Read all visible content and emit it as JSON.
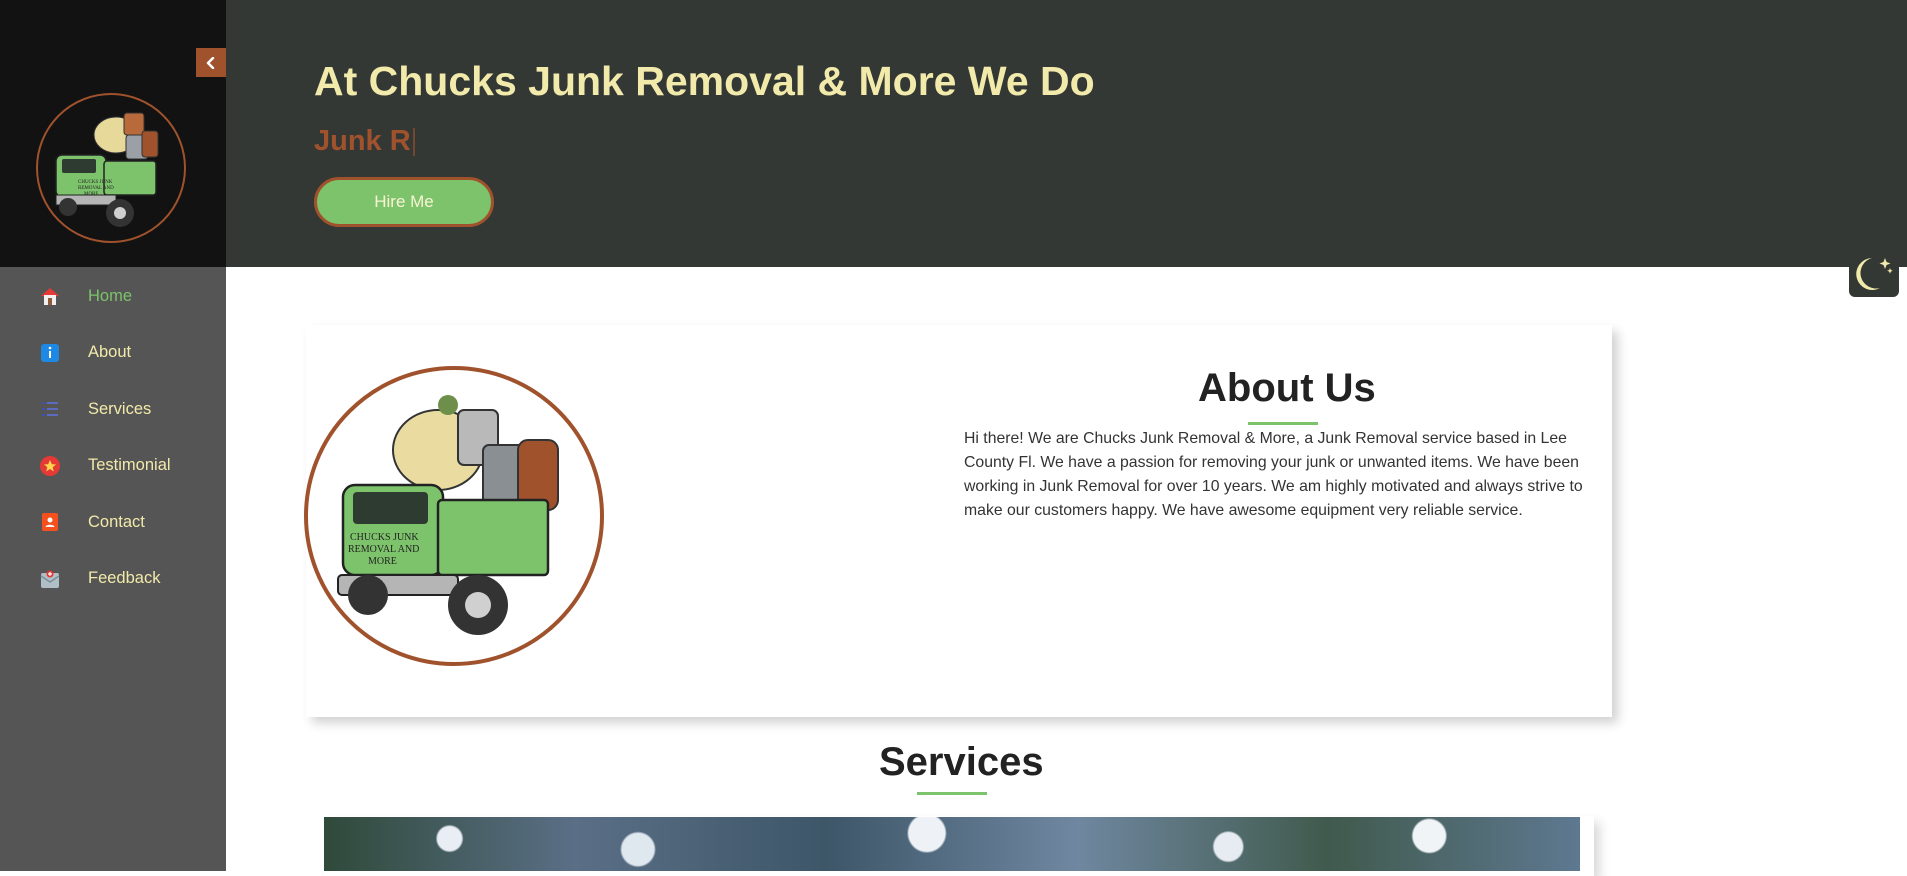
{
  "sidebar": {
    "toggle_icon": "chevron-left-icon",
    "logo_alt": "Chucks Junk Removal and More logo",
    "logo_truck_text": "CHUCKS JUNK REMOVAL AND MORE",
    "items": [
      {
        "label": "Home",
        "icon": "home-icon",
        "active": true
      },
      {
        "label": "About",
        "icon": "info-icon",
        "active": false
      },
      {
        "label": "Services",
        "icon": "list-icon",
        "active": false
      },
      {
        "label": "Testimonial",
        "icon": "star-icon",
        "active": false
      },
      {
        "label": "Contact",
        "icon": "contact-icon",
        "active": false
      },
      {
        "label": "Feedback",
        "icon": "feedback-icon",
        "active": false
      }
    ]
  },
  "hero": {
    "title": "At Chucks Junk Removal & More We Do",
    "typed_text": "Junk R",
    "hire_button": "Hire Me"
  },
  "mode_toggle": {
    "icon": "moon-icon"
  },
  "about": {
    "heading": "About Us",
    "text": "Hi there! We are Chucks Junk Removal & More, a Junk Removal service based in Lee County Fl. We have a passion for removing your junk or unwanted items. We have been working in Junk Removal for over 10 years. We am highly motivated and always strive to make our customers happy. We have awesome equipment very reliable service.",
    "truck_text": "CHUCKS JUNK REMOVAL AND MORE"
  },
  "services": {
    "heading": "Services"
  },
  "colors": {
    "accent_green": "#7dc36b",
    "accent_brown": "#a0522d",
    "text_cream": "#f2eaaa",
    "hero_bg": "#333835",
    "sidebar_bg": "#555555"
  }
}
